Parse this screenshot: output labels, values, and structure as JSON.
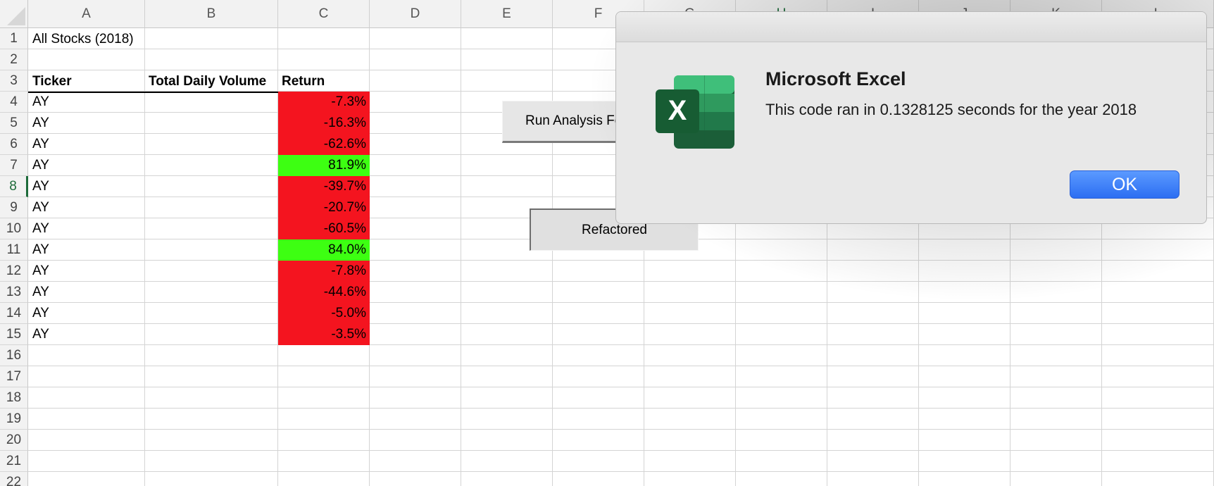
{
  "columns": [
    "A",
    "B",
    "C",
    "D",
    "E",
    "F",
    "G",
    "H",
    "I",
    "J",
    "K",
    "L"
  ],
  "selected_column": "H",
  "rows": [
    "1",
    "2",
    "3",
    "4",
    "5",
    "6",
    "7",
    "8",
    "9",
    "10",
    "11",
    "12",
    "13",
    "14",
    "15",
    "16",
    "17",
    "18",
    "19",
    "20",
    "21",
    "22"
  ],
  "selected_row": "8",
  "sheet": {
    "title": "All Stocks (2018)",
    "headers": {
      "ticker": "Ticker",
      "volume": "Total Daily Volume",
      "return": "Return"
    },
    "data_rows": [
      {
        "ticker": "AY",
        "volume": "",
        "return": "-7.3%",
        "status": "negative"
      },
      {
        "ticker": "AY",
        "volume": "",
        "return": "-16.3%",
        "status": "negative"
      },
      {
        "ticker": "AY",
        "volume": "",
        "return": "-62.6%",
        "status": "negative"
      },
      {
        "ticker": "AY",
        "volume": "",
        "return": "81.9%",
        "status": "positive"
      },
      {
        "ticker": "AY",
        "volume": "",
        "return": "-39.7%",
        "status": "negative"
      },
      {
        "ticker": "AY",
        "volume": "",
        "return": "-20.7%",
        "status": "negative"
      },
      {
        "ticker": "AY",
        "volume": "",
        "return": "-60.5%",
        "status": "negative"
      },
      {
        "ticker": "AY",
        "volume": "",
        "return": "84.0%",
        "status": "positive"
      },
      {
        "ticker": "AY",
        "volume": "",
        "return": "-7.8%",
        "status": "negative"
      },
      {
        "ticker": "AY",
        "volume": "",
        "return": "-44.6%",
        "status": "negative"
      },
      {
        "ticker": "AY",
        "volume": "",
        "return": "-5.0%",
        "status": "negative"
      },
      {
        "ticker": "AY",
        "volume": "",
        "return": "-3.5%",
        "status": "negative"
      }
    ]
  },
  "buttons": {
    "run_analysis": "Run Analysis Fo",
    "refactored": "Refactored"
  },
  "dialog": {
    "title": "Microsoft Excel",
    "message": "This code ran in 0.1328125 seconds for the year 2018",
    "ok_label": "OK",
    "icon": "excel-app-icon",
    "icon_letter": "X"
  },
  "colors": {
    "negative_fill": "#f4141f",
    "positive_fill": "#3dff12",
    "ok_button": "#2c6ef2",
    "excel_green": "#1d6b3a"
  }
}
